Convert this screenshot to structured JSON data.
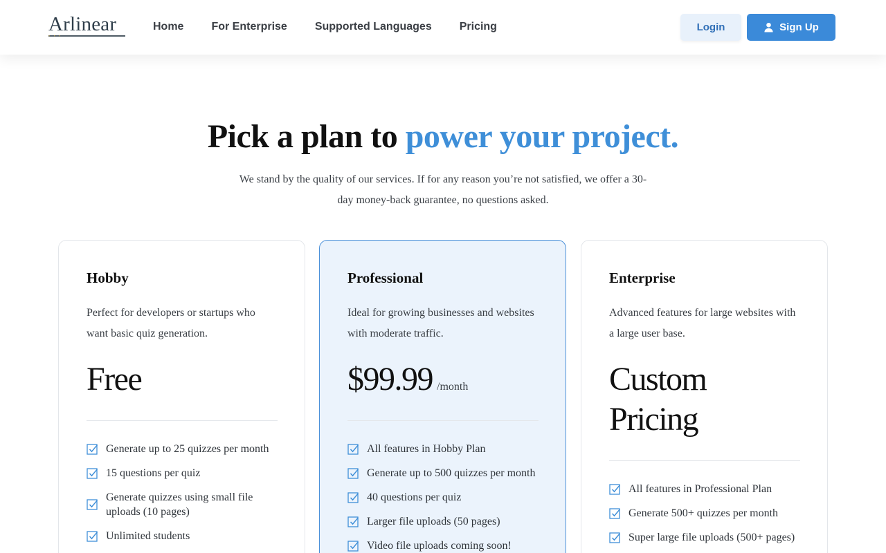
{
  "header": {
    "logo": "Arlinear",
    "nav": [
      "Home",
      "For Enterprise",
      "Supported Languages",
      "Pricing"
    ],
    "login_label": "Login",
    "signup_label": "Sign Up"
  },
  "hero": {
    "title_main": "Pick a plan to",
    "title_accent": "power your project.",
    "subtitle": "We stand by the quality of our services. If for any reason you’re not satisfied, we offer a 30-day money-back guarantee, no questions asked."
  },
  "colors": {
    "accent": "#3f8fd8",
    "signup_bg": "#3b8ad9",
    "featured_bg": "#ebf3fc"
  },
  "plans": [
    {
      "name": "Hobby",
      "description": "Perfect for developers or startups who want basic quiz generation.",
      "price": "Free",
      "period": "",
      "features": [
        "Generate up to 25 quizzes per month",
        "15 questions per quiz",
        "Generate quizzes using small file uploads (10 pages)",
        "Unlimited students"
      ]
    },
    {
      "name": "Professional",
      "description": "Ideal for growing businesses and websites with moderate traffic.",
      "price": "$99.99",
      "period": "/month",
      "features": [
        "All features in Hobby Plan",
        "Generate up to 500 quizzes per month",
        "40 questions per quiz",
        "Larger file uploads (50 pages)",
        "Video file uploads coming soon!"
      ]
    },
    {
      "name": "Enterprise",
      "description": "Advanced features for large websites with a large user base.",
      "price": "Custom Pricing",
      "period": "",
      "features": [
        "All features in Professional Plan",
        "Generate 500+ quizzes per month",
        "Super large file uploads (500+ pages)"
      ]
    }
  ]
}
